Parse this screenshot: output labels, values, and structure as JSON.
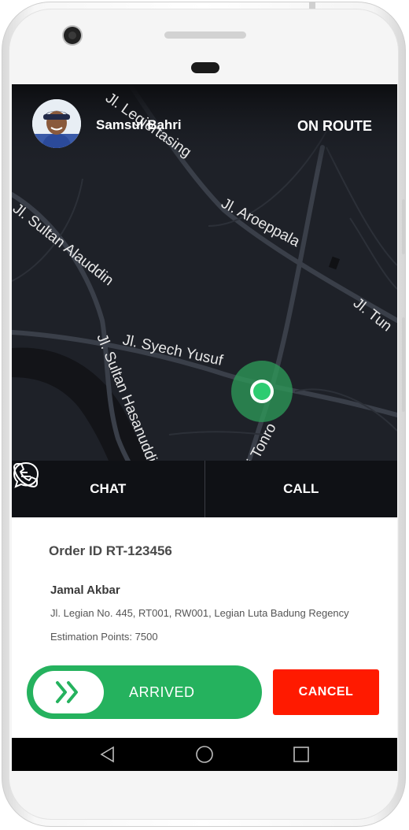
{
  "header": {
    "driver_name": "Samsul Bahri",
    "status": "ON ROUTE"
  },
  "map": {
    "streets": [
      "Jl. Legiertasing",
      "Jl. Aroeppala",
      "Jl. Sultan Alauddin",
      "Jl. Syech Yusuf",
      "Jl. Sultan Hasanuddin",
      "Jl. Andi Tonro",
      "Jl. Tun"
    ],
    "marker_color": "#2ecc71"
  },
  "actions": {
    "chat_label": "CHAT",
    "call_label": "CALL"
  },
  "order": {
    "id_text": "Order ID RT-123456",
    "customer_name": "Jamal Akbar",
    "address": "Jl. Legian No. 445, RT001, RW001, Legian Luta Badung Regency",
    "estimation": "Estimation Points: 7500"
  },
  "buttons": {
    "arrived_label": "ARRIVED",
    "cancel_label": "CANCEL"
  },
  "colors": {
    "accent_green": "#25b25e",
    "cancel_red": "#ff1a00",
    "map_bg": "#1e2128"
  }
}
